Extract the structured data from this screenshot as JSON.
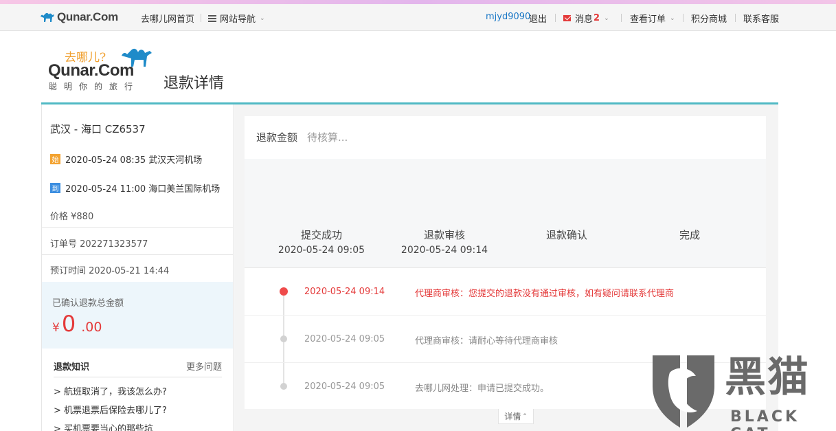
{
  "topbar": {
    "brand": "Qunar.Com",
    "home": "去哪儿网首页",
    "site_nav": "网站导航",
    "username": "mjyd9090",
    "logout": "退出",
    "messages_label": "消息",
    "messages_count": "2",
    "orders": "查看订单",
    "points": "积分商城",
    "service": "联系客服"
  },
  "header": {
    "logo_cn": "去哪儿?",
    "logo_brand": "Qunar.Com",
    "logo_slogan": "聪明你的旅行",
    "title": "退款详情"
  },
  "flight": {
    "title": "武汉 - 海口 CZ6537",
    "departure_badge": "始",
    "departure": "2020-05-24 08:35 武汉天河机场",
    "arrival_badge": "到",
    "arrival": "2020-05-24 11:00 海口美兰国际机场",
    "price": "价格 ¥880",
    "order_no": "订单号 202271323577",
    "order_time": "预订时间 2020-05-21 14:44"
  },
  "refund_total": {
    "label": "已确认退款总金额",
    "currency": "¥",
    "integer": "0",
    "decimal": ".00"
  },
  "knowledge": {
    "title": "退款知识",
    "more": "更多问题",
    "items": [
      "> 航班取消了，我该怎么办?",
      "> 机票退票后保险去哪儿了?",
      "> 买机票要当心的那些坑"
    ]
  },
  "refund_amount": {
    "label": "退款金额",
    "value": "待核算..."
  },
  "steps": [
    {
      "name": "提交成功",
      "time": "2020-05-24 09:05"
    },
    {
      "name": "退款审核",
      "time": "2020-05-24 09:14"
    },
    {
      "name": "退款确认",
      "time": ""
    },
    {
      "name": "完成",
      "time": ""
    }
  ],
  "timeline": [
    {
      "time": "2020-05-24 09:14",
      "text": "代理商审核：您提交的退款没有通过审核，如有疑问请联系代理商"
    },
    {
      "time": "2020-05-24 09:05",
      "text": "代理商审核：请耐心等待代理商审核"
    },
    {
      "time": "2020-05-24 09:05",
      "text": "去哪儿网处理：申请已提交成功。"
    }
  ],
  "detail_toggle": "详情",
  "watermark": {
    "cn": "黑猫",
    "en": "BLACK CAT"
  },
  "colors": {
    "accent_teal": "#4fb9c4",
    "alert_red": "#e43a3a",
    "link_blue": "#1a77c6"
  }
}
